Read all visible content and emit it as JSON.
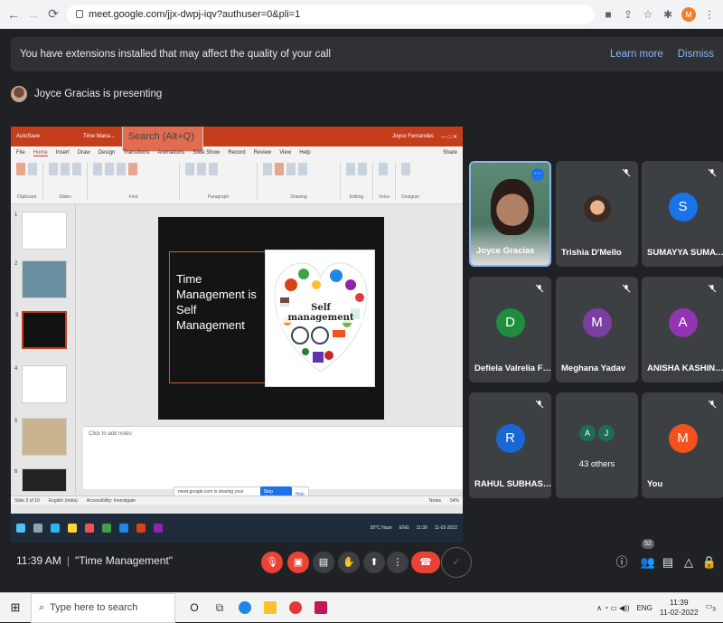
{
  "browser": {
    "url": "meet.google.com/jjx-dwpj-iqv?authuser=0&pli=1",
    "profile_initial": "M"
  },
  "banner": {
    "message": "You have extensions installed that may affect the quality of your call",
    "learn_more": "Learn more",
    "dismiss": "Dismiss"
  },
  "presenting": {
    "text": "Joyce Gracias is presenting"
  },
  "shared_screen": {
    "app_label": "AutoSave",
    "doc_title": "Time Mana...",
    "search": "Search (Alt+Q)",
    "user": "Joyce Fernandes",
    "share_btn": "Share",
    "tabs": [
      "File",
      "Home",
      "Insert",
      "Draw",
      "Design",
      "Transitions",
      "Animations",
      "Slide Show",
      "Record",
      "Review",
      "View",
      "Help"
    ],
    "ribbon_groups": [
      "Clipboard",
      "Slides",
      "Font",
      "Paragraph",
      "Drawing",
      "Editing",
      "Voice",
      "Designer"
    ],
    "slide_title": "Time Management is Self Management",
    "image_caption": "Self management",
    "notes_placeholder": "Click to add notes",
    "status_slide": "Slide 3 of 10",
    "status_lang": "English (India)",
    "status_access": "Accessibility: Investigate",
    "status_notes": "Notes",
    "status_zoom": "54%",
    "share_notice": "meet.google.com is sharing your screen.",
    "stop_sharing": "Stop sharing",
    "hide": "Hide",
    "inner_weather": "30°C Haze",
    "inner_lang": "ENG",
    "inner_time": "11:39",
    "inner_date": "11-02-2022",
    "thumb_numbers": [
      "1",
      "2",
      "3",
      "4",
      "5",
      "6"
    ]
  },
  "participants": [
    {
      "name": "Joyce Gracias",
      "type": "video"
    },
    {
      "name": "Trishia D'Mello",
      "type": "photo"
    },
    {
      "name": "SUMAYYA SUMAYYA",
      "initial": "S",
      "color": "#1a73e8"
    },
    {
      "name": "Defiela Valrelia Fern...",
      "initial": "D",
      "color": "#1e8e3e"
    },
    {
      "name": "Meghana Yadav",
      "initial": "M",
      "color": "#7b3fa3"
    },
    {
      "name": "ANISHA KASHINAT...",
      "initial": "A",
      "color": "#9334b2"
    },
    {
      "name": "RAHUL SUBHASH G...",
      "initial": "R",
      "color": "#1967d2"
    },
    {
      "name": "43 others",
      "initials": [
        "A",
        "J"
      ]
    },
    {
      "name": "You",
      "initial": "M",
      "color": "#f4511e"
    }
  ],
  "controls": {
    "time": "11:39 AM",
    "meeting_name": "\"Time Management\"",
    "people_count": "52"
  },
  "taskbar": {
    "search_placeholder": "Type here to search",
    "lang": "ENG",
    "time": "11:39",
    "date": "11-02-2022",
    "notif": "3"
  }
}
